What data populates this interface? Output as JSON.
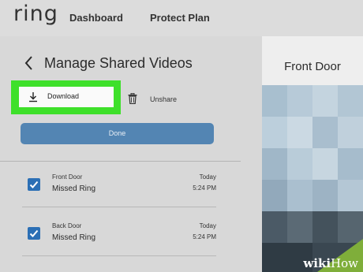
{
  "header": {
    "logo": "ring",
    "nav": [
      "Dashboard",
      "Protect Plan"
    ]
  },
  "panel": {
    "title": "Manage Shared Videos",
    "download_label": "Download",
    "unshare_label": "Unshare",
    "done_label": "Done",
    "items": [
      {
        "location": "Front Door",
        "event": "Missed Ring",
        "day": "Today",
        "time": "5:24 PM",
        "checked": true
      },
      {
        "location": "Back Door",
        "event": "Missed Ring",
        "day": "Today",
        "time": "5:24 PM",
        "checked": true
      }
    ]
  },
  "preview": {
    "title": "Front Door"
  },
  "watermark": {
    "part1": "wiki",
    "part2": "How"
  },
  "colors": {
    "highlight": "#3ee02a",
    "done_button": "#5385b3",
    "checkbox": "#2b6fb5"
  }
}
